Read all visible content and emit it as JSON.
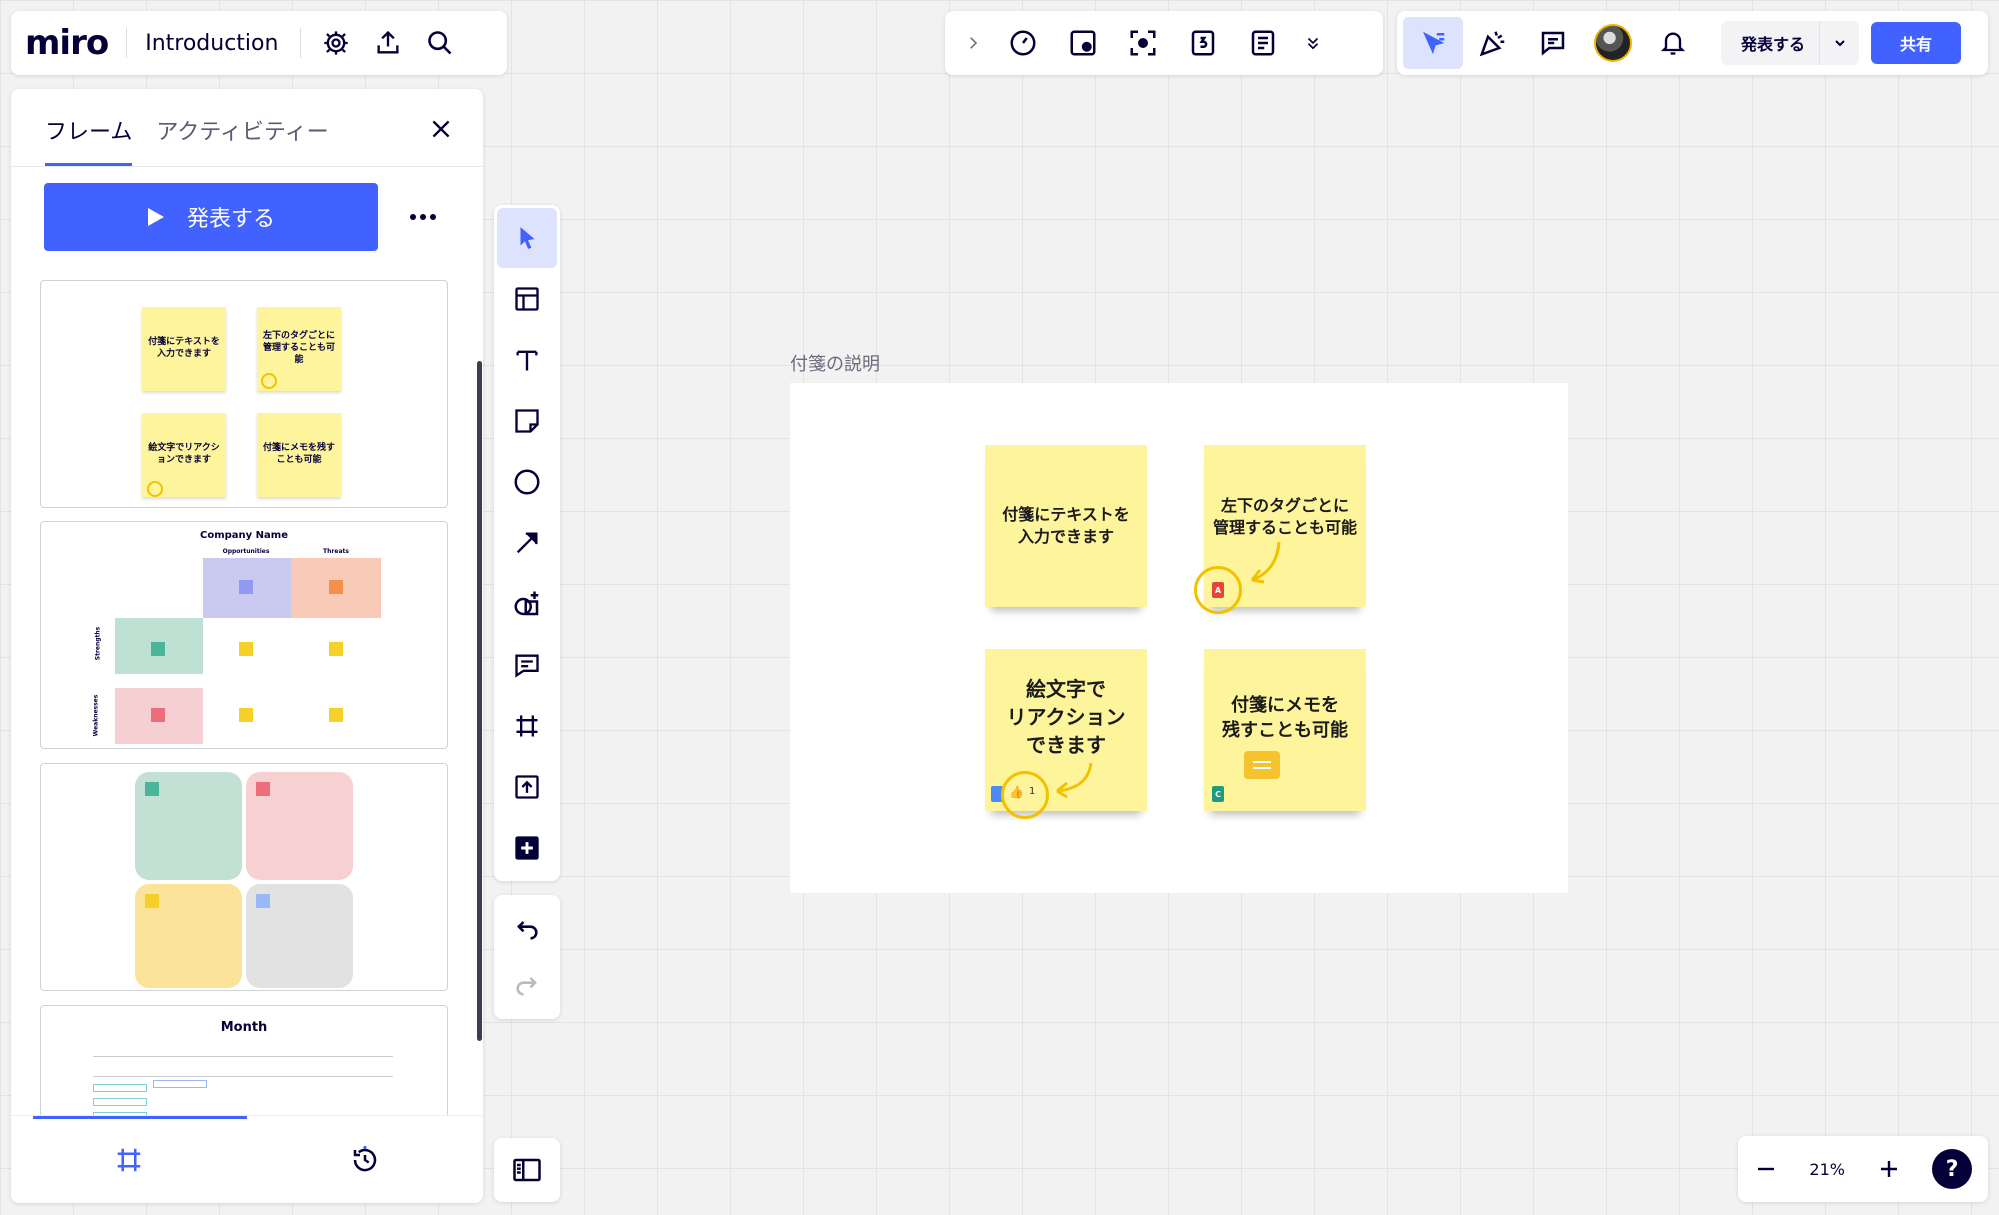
{
  "app": {
    "logo": "miro",
    "board_title": "Introduction"
  },
  "header": {
    "present_label": "発表する",
    "share_label": "共有"
  },
  "frames_panel": {
    "tabs": [
      {
        "label": "フレーム",
        "active": true
      },
      {
        "label": "アクティビティー",
        "active": false
      }
    ],
    "present_button_label": "発表する",
    "thumbnails": [
      {
        "stickies": [
          "付箋にテキストを入力できます",
          "左下のタグごとに管理することも可能",
          "絵文字でリアクションできます",
          "付箋にメモを残すことも可能"
        ]
      },
      {
        "title": "Company Name",
        "col1": "Opportunities",
        "col2": "Threats",
        "row1": "Strengths",
        "row2": "Weaknesses"
      },
      {},
      {
        "title": "Month"
      }
    ]
  },
  "canvas": {
    "frame_label": "付箋の説明",
    "stickies": [
      {
        "text": "付箋にテキストを入力できます",
        "lines": [
          "付箋にテキストを",
          "入力できます"
        ]
      },
      {
        "text": "左下のタグごとに管理することも可能",
        "lines": [
          "左下のタグごとに",
          "管理することも可能"
        ],
        "tag": "A"
      },
      {
        "text": "絵文字でリアクションできます",
        "lines": [
          "絵文字で",
          "リアクション",
          "できます"
        ],
        "reaction_count": "1"
      },
      {
        "text": "付箋にメモを残すことも可能",
        "lines": [
          "付箋にメモを",
          "残すことも可能"
        ],
        "tag": "C"
      }
    ]
  },
  "zoom": {
    "value": "21%"
  },
  "help_label": "?",
  "colors": {
    "accent": "#4262ff",
    "sticky_yellow": "#fef49c",
    "highlight_ring": "#f2c200",
    "dark": "#050038"
  }
}
